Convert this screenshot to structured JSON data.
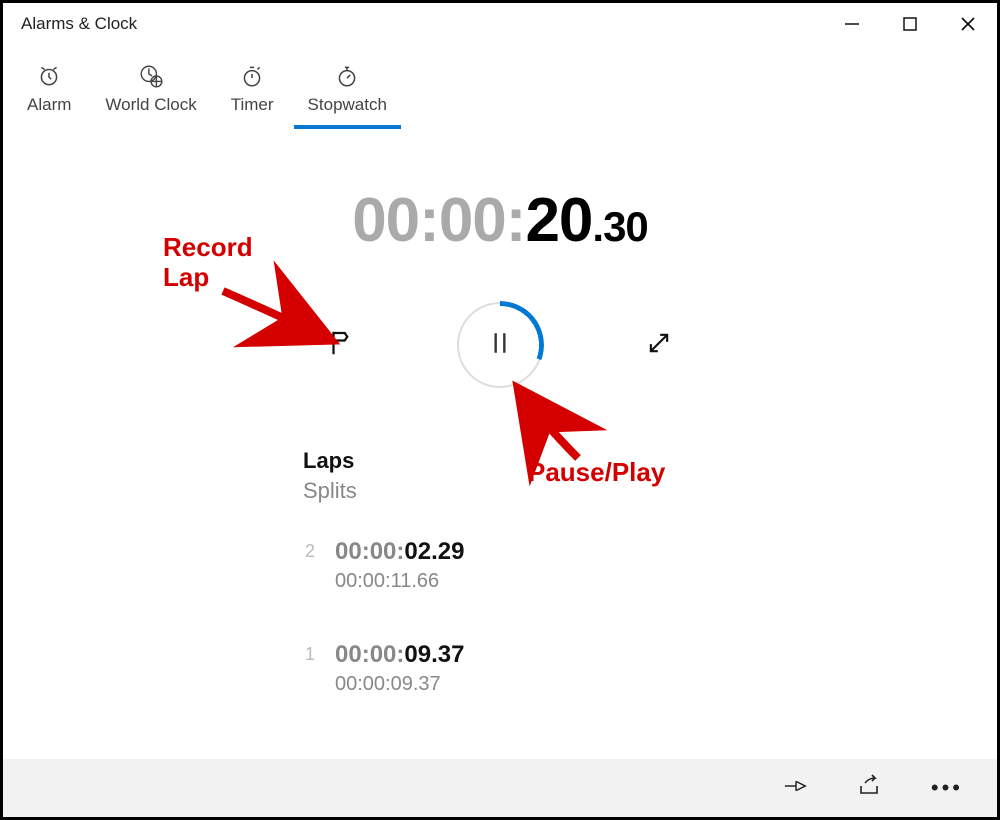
{
  "window": {
    "title": "Alarms & Clock"
  },
  "tabs": [
    {
      "label": "Alarm"
    },
    {
      "label": "World Clock"
    },
    {
      "label": "Timer"
    },
    {
      "label": "Stopwatch"
    }
  ],
  "active_tab": "Stopwatch",
  "stopwatch": {
    "time_hh": "00",
    "time_mm": "00",
    "time_ss": "20",
    "time_hund": "30",
    "colon": ":",
    "dot": "."
  },
  "laps_section": {
    "label_laps": "Laps",
    "label_splits": "Splits",
    "items": [
      {
        "index": "2",
        "lap_hhmm": "00:00:",
        "lap_ss": "02.29",
        "split": "00:00:11.66"
      },
      {
        "index": "1",
        "lap_hhmm": "00:00:",
        "lap_ss": "09.37",
        "split": "00:00:09.37"
      }
    ]
  },
  "annotations": {
    "record_lap_line1": "Record",
    "record_lap_line2": "Lap",
    "pause_play": "Pause/Play"
  },
  "colors": {
    "accent": "#0078d4",
    "anno": "#d40000"
  }
}
